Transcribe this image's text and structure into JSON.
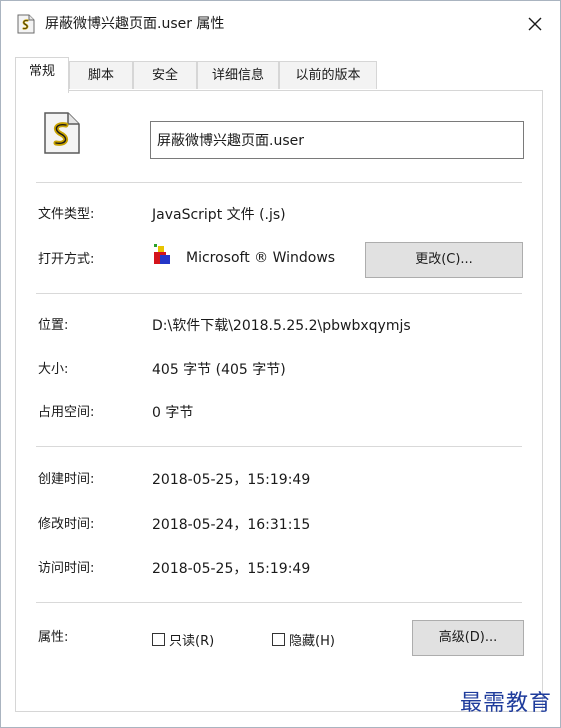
{
  "window": {
    "title": "屏蔽微博兴趣页面.user 属性",
    "close_glyph": "✕"
  },
  "tabs": [
    {
      "label": "常规",
      "active": true
    },
    {
      "label": "脚本",
      "active": false
    },
    {
      "label": "安全",
      "active": false
    },
    {
      "label": "详细信息",
      "active": false
    },
    {
      "label": "以前的版本",
      "active": false
    }
  ],
  "general": {
    "file_name": "屏蔽微博兴趣页面.user",
    "file_type": {
      "label": "文件类型:",
      "value": "JavaScript 文件 (.js)"
    },
    "opens_with": {
      "label": "打开方式:",
      "value": "Microsoft ® Windows",
      "change_button": "更改(C)..."
    },
    "location": {
      "label": "位置:",
      "value": "D:\\软件下载\\2018.5.25.2\\pbwbxqymjs"
    },
    "size": {
      "label": "大小:",
      "value": "405 字节 (405 字节)"
    },
    "size_on_disk": {
      "label": "占用空间:",
      "value": "0 字节"
    },
    "created": {
      "label": "创建时间:",
      "value": "2018-05-25，15:19:49"
    },
    "modified": {
      "label": "修改时间:",
      "value": "2018-05-24，16:31:15"
    },
    "accessed": {
      "label": "访问时间:",
      "value": "2018-05-25，15:19:49"
    },
    "attributes": {
      "label": "属性:",
      "readonly": {
        "label": "只读(R)",
        "checked": false
      },
      "hidden": {
        "label": "隐藏(H)",
        "checked": false
      },
      "advanced_button": "高级(D)..."
    }
  },
  "watermark": "最需教育",
  "icons": {
    "title": "script-file-icon",
    "file": "script-file-icon",
    "app": "windows-script-host-icon",
    "close": "close-icon"
  },
  "colors": {
    "tab_inactive": "#f3f3f3",
    "button_face": "#e1e1e1",
    "separator": "#d9d9d9",
    "watermark": "#1f3c9c"
  }
}
